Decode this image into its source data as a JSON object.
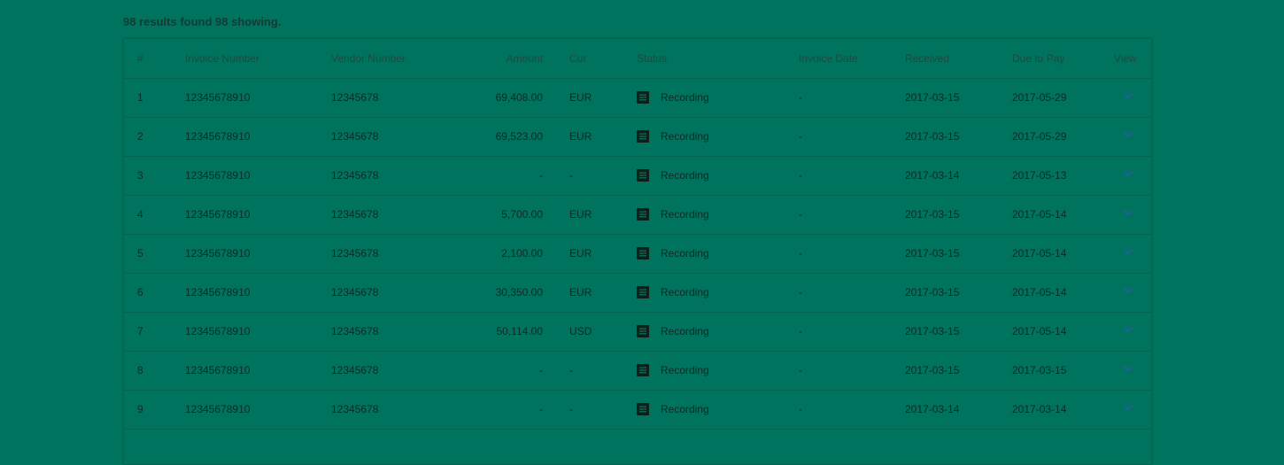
{
  "summary": "98 results found 98 showing.",
  "columns": {
    "num": "#",
    "invoice_number": "Invoice Number",
    "vendor_number": "Vendor Number",
    "amount": "Amount",
    "cur": "Cur",
    "status": "Status",
    "invoice_date": "Invoice Date",
    "received": "Received",
    "due_to_pay": "Due to Pay",
    "view": "View"
  },
  "rows": [
    {
      "num": "1",
      "invoice_number": "12345678910",
      "vendor_number": "12345678",
      "amount": "69,408.00",
      "cur": "EUR",
      "status": "Recording",
      "invoice_date": "-",
      "received": "2017-03-15",
      "due_to_pay": "2017-05-29"
    },
    {
      "num": "2",
      "invoice_number": "12345678910",
      "vendor_number": "12345678",
      "amount": "69,523.00",
      "cur": "EUR",
      "status": "Recording",
      "invoice_date": "-",
      "received": "2017-03-15",
      "due_to_pay": "2017-05-29"
    },
    {
      "num": "3",
      "invoice_number": "12345678910",
      "vendor_number": "12345678",
      "amount": "-",
      "cur": "-",
      "status": "Recording",
      "invoice_date": "-",
      "received": "2017-03-14",
      "due_to_pay": "2017-05-13"
    },
    {
      "num": "4",
      "invoice_number": "12345678910",
      "vendor_number": "12345678",
      "amount": "5,700.00",
      "cur": "EUR",
      "status": "Recording",
      "invoice_date": "-",
      "received": "2017-03-15",
      "due_to_pay": "2017-05-14"
    },
    {
      "num": "5",
      "invoice_number": "12345678910",
      "vendor_number": "12345678",
      "amount": "2,100.00",
      "cur": "EUR",
      "status": "Recording",
      "invoice_date": "-",
      "received": "2017-03-15",
      "due_to_pay": "2017-05-14"
    },
    {
      "num": "6",
      "invoice_number": "12345678910",
      "vendor_number": "12345678",
      "amount": "30,350.00",
      "cur": "EUR",
      "status": "Recording",
      "invoice_date": "-",
      "received": "2017-03-15",
      "due_to_pay": "2017-05-14"
    },
    {
      "num": "7",
      "invoice_number": "12345678910",
      "vendor_number": "12345678",
      "amount": "50,114.00",
      "cur": "USD",
      "status": "Recording",
      "invoice_date": "-",
      "received": "2017-03-15",
      "due_to_pay": "2017-05-14"
    },
    {
      "num": "8",
      "invoice_number": "12345678910",
      "vendor_number": "12345678",
      "amount": "-",
      "cur": "-",
      "status": "Recording",
      "invoice_date": "-",
      "received": "2017-03-15",
      "due_to_pay": "2017-03-15"
    },
    {
      "num": "9",
      "invoice_number": "12345678910",
      "vendor_number": "12345678",
      "amount": "-",
      "cur": "-",
      "status": "Recording",
      "invoice_date": "-",
      "received": "2017-03-14",
      "due_to_pay": "2017-03-14"
    }
  ],
  "icons": {
    "status": "document-icon",
    "view": "chevron-down-icon"
  },
  "colors": {
    "background": "#00735f",
    "chevron": "#2a5ba8"
  }
}
